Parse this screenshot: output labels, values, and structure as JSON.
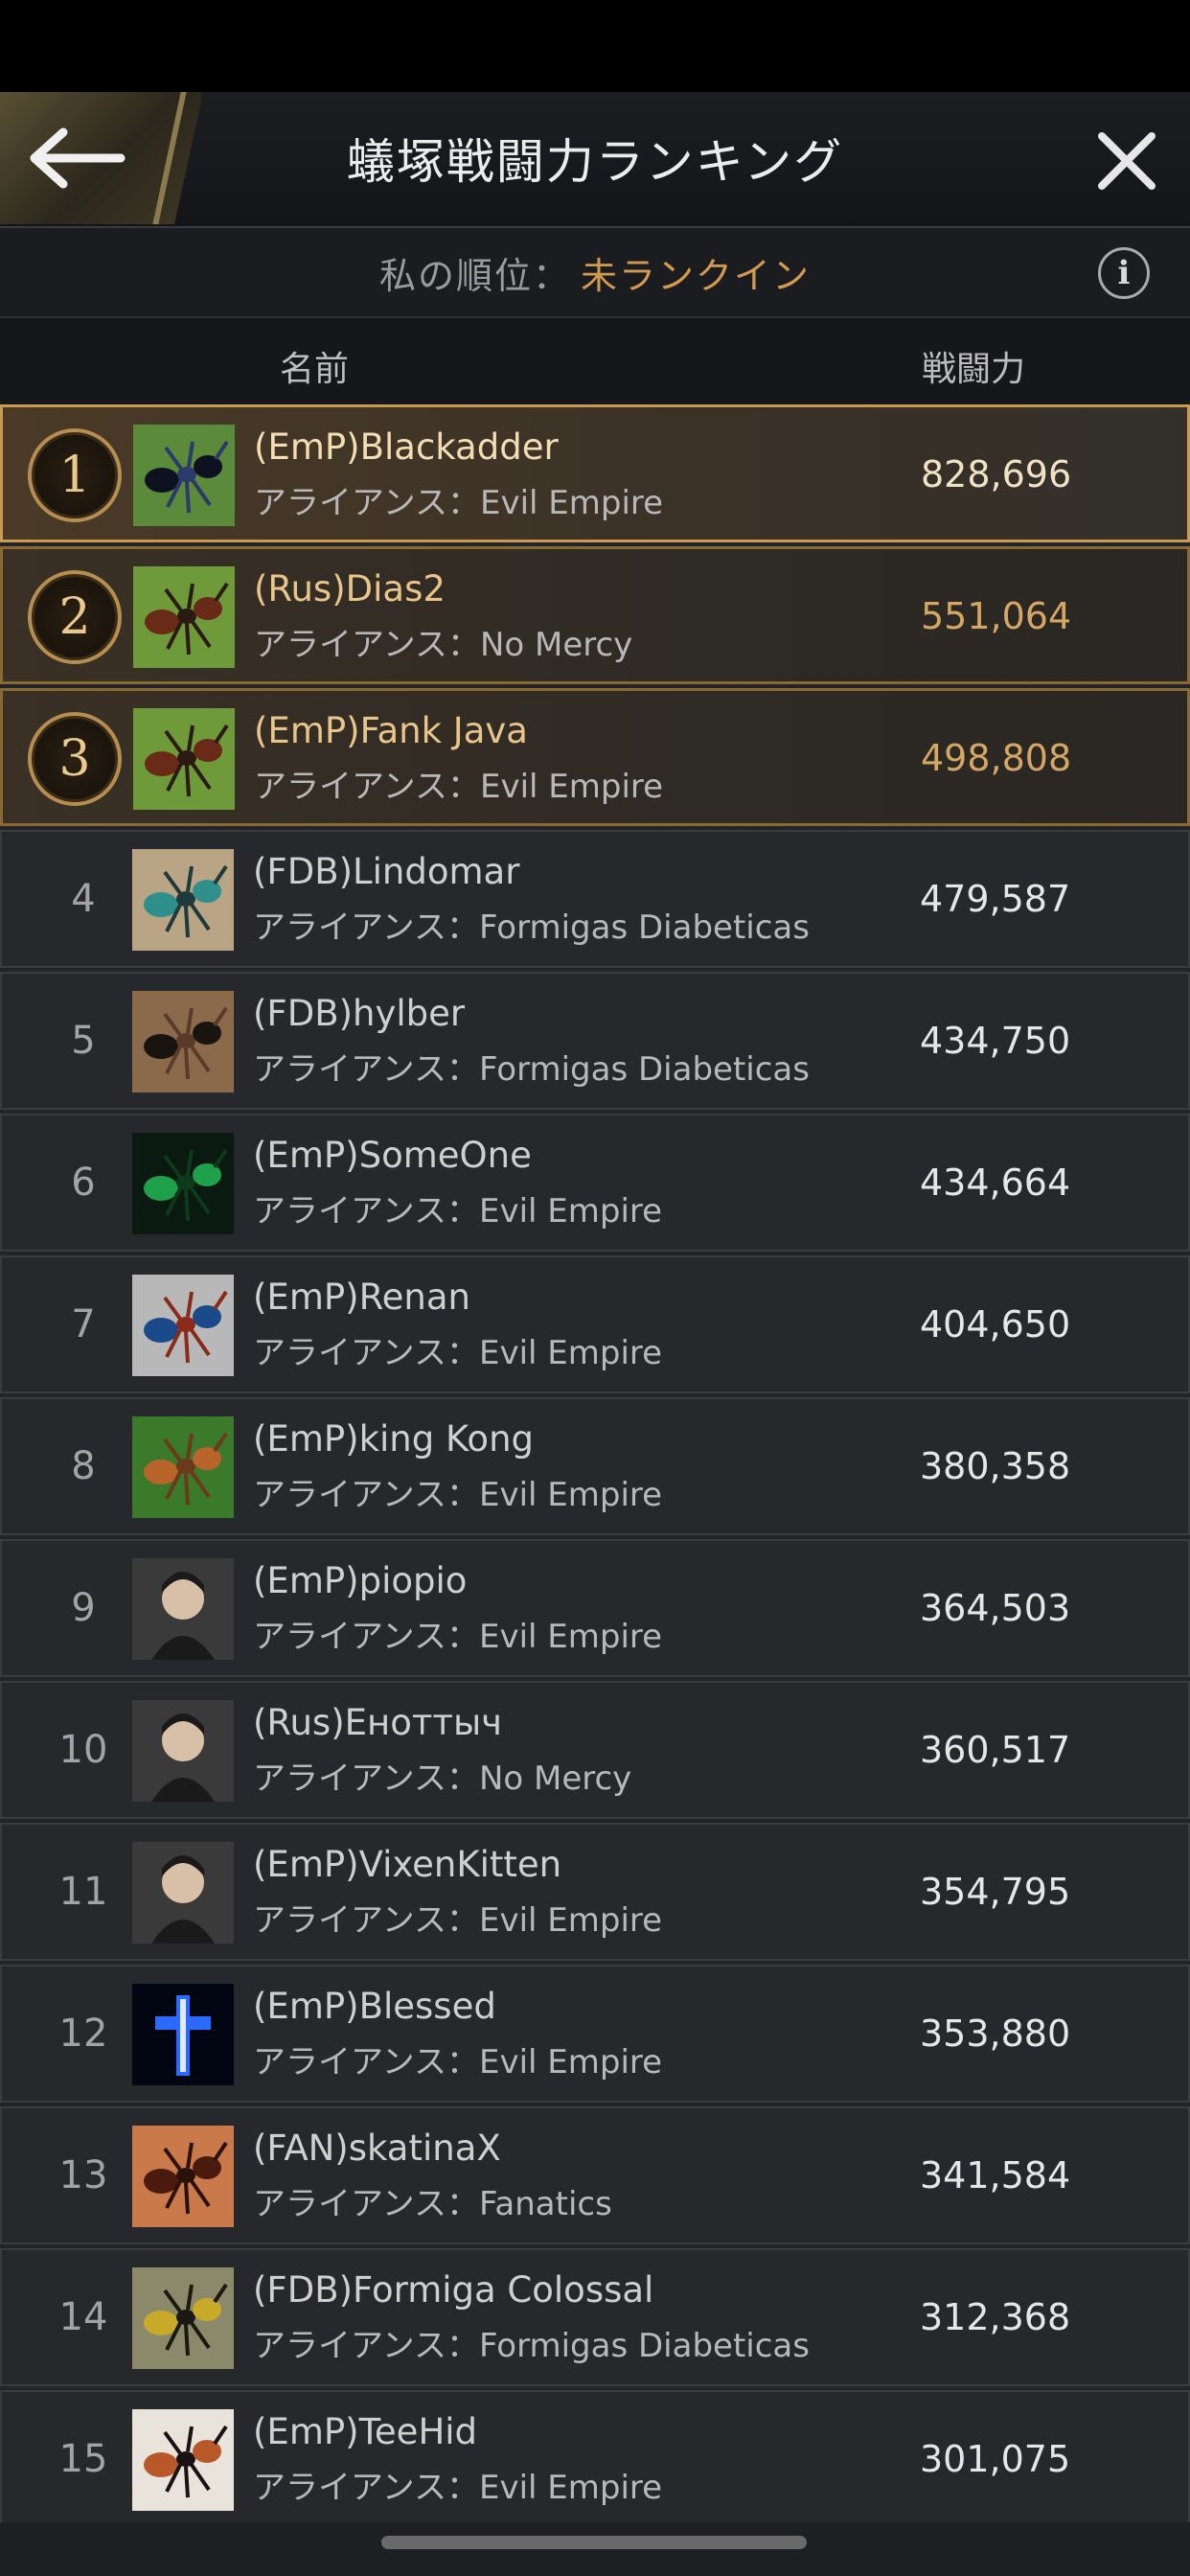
{
  "header": {
    "title": "蟻塚戦闘力ランキング"
  },
  "my_rank": {
    "label": "私の順位：",
    "value": "未ランクイン"
  },
  "columns": {
    "name": "名前",
    "power": "戦闘力"
  },
  "rankings": [
    {
      "rank": "1",
      "name": "(EmP)Blackadder",
      "alliance": "アライアンス：Evil Empire",
      "power": "828,696"
    },
    {
      "rank": "2",
      "name": "(Rus)Dias2",
      "alliance": "アライアンス：No Mercy",
      "power": "551,064"
    },
    {
      "rank": "3",
      "name": "(EmP)Fank Java",
      "alliance": "アライアンス：Evil Empire",
      "power": "498,808"
    },
    {
      "rank": "4",
      "name": "(FDB)Lindomar",
      "alliance": "アライアンス：Formigas Diabeticas",
      "power": "479,587"
    },
    {
      "rank": "5",
      "name": "(FDB)hylber",
      "alliance": "アライアンス：Formigas Diabeticas",
      "power": "434,750"
    },
    {
      "rank": "6",
      "name": "(EmP)SomeOne",
      "alliance": "アライアンス：Evil Empire",
      "power": "434,664"
    },
    {
      "rank": "7",
      "name": "(EmP)Renan",
      "alliance": "アライアンス：Evil Empire",
      "power": "404,650"
    },
    {
      "rank": "8",
      "name": "(EmP)king Kong",
      "alliance": "アライアンス：Evil Empire",
      "power": "380,358"
    },
    {
      "rank": "9",
      "name": "(EmP)piopio",
      "alliance": "アライアンス：Evil Empire",
      "power": "364,503"
    },
    {
      "rank": "10",
      "name": "(Rus)Еноттыч",
      "alliance": "アライアンス：No Mercy",
      "power": "360,517"
    },
    {
      "rank": "11",
      "name": "(EmP)VixenKitten",
      "alliance": "アライアンス：Evil Empire",
      "power": "354,795"
    },
    {
      "rank": "12",
      "name": "(EmP)Blessed",
      "alliance": "アライアンス：Evil Empire",
      "power": "353,880"
    },
    {
      "rank": "13",
      "name": "(FAN)skatinaX",
      "alliance": "アライアンス：Fanatics",
      "power": "341,584"
    },
    {
      "rank": "14",
      "name": "(FDB)Formiga Colossal",
      "alliance": "アライアンス：Formigas Diabeticas",
      "power": "312,368"
    },
    {
      "rank": "15",
      "name": "(EmP)TeeHid",
      "alliance": "アライアンス：Evil Empire",
      "power": "301,075"
    }
  ],
  "avatar_icons": [
    "black-ant-avatar-icon",
    "red-ant-avatar-icon",
    "red-ant-avatar-icon",
    "teal-ant-avatar-icon",
    "dark-ant-avatar-icon",
    "green-ant-avatar-icon",
    "blue-ant-avatar-icon",
    "orange-ant-avatar-icon",
    "person-avatar-icon",
    "person-avatar-icon",
    "person-avatar-icon",
    "cross-avatar-icon",
    "brown-ant-avatar-icon",
    "yellow-ant-avatar-icon",
    "orange-beetle-avatar-icon"
  ],
  "colors": {
    "gold_accent": "#c99a52",
    "rank_highlight_text": "#d29a4e",
    "row_bg": "#27282c"
  }
}
